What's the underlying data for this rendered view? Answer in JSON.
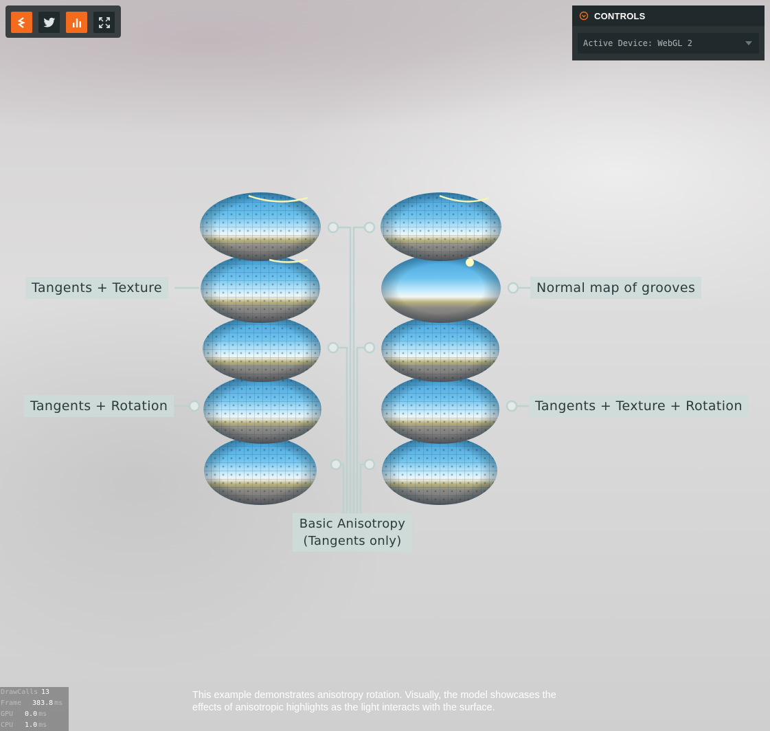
{
  "toolbar": {
    "buttons": [
      {
        "name": "playcanvas-logo-button",
        "icon": "playcanvas-logo-icon"
      },
      {
        "name": "twitter-button",
        "icon": "twitter-icon"
      },
      {
        "name": "stats-button",
        "icon": "bar-chart-icon"
      },
      {
        "name": "fullscreen-button",
        "icon": "fullscreen-icon"
      }
    ],
    "accent": "#f36b1c"
  },
  "controls": {
    "title": "CONTROLS",
    "device_select": "Active Device: WebGL 2"
  },
  "labels": {
    "tangents_texture": "Tangents + Texture",
    "tangents_rotation": "Tangents + Rotation",
    "normal_map": "Normal map of grooves",
    "tangents_texture_rotation": "Tangents + Texture + Rotation",
    "basic_line1": "Basic Anisotropy",
    "basic_line2": "(Tangents only)"
  },
  "stats": [
    {
      "label": "DrawCalls",
      "value": "13",
      "unit": ""
    },
    {
      "label": "Frame",
      "value": "383.8",
      "unit": "ms"
    },
    {
      "label": "GPU",
      "value": "0.0",
      "unit": "ms"
    },
    {
      "label": "CPU",
      "value": "1.0",
      "unit": "ms"
    }
  ],
  "description": "This example demonstrates anisotropy rotation. Visually, the model showcases the effects of anisotropic highlights as the light interacts with the surface."
}
